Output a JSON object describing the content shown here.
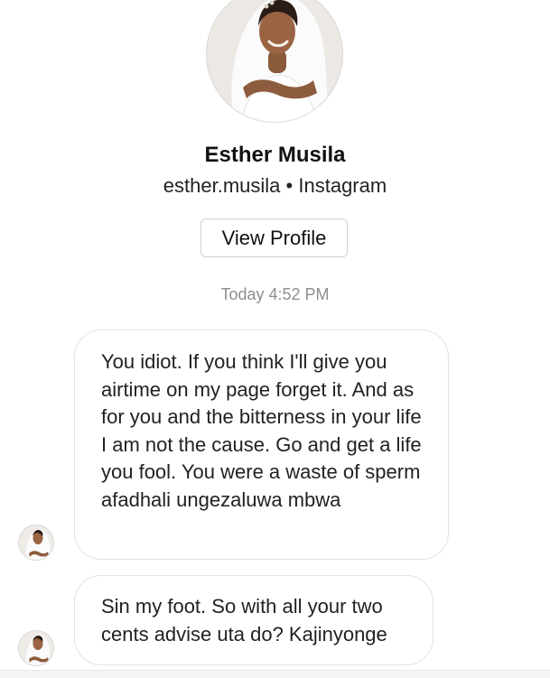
{
  "profile": {
    "name": "Esther Musila",
    "username": "esther.musila",
    "separator": "•",
    "platform": "Instagram",
    "view_profile_label": "View Profile"
  },
  "thread": {
    "timestamp": "Today 4:52 PM",
    "messages": [
      {
        "text": "You idiot. If you think I'll give you airtime on my page forget it. And as for you and the bitterness in your life I am not the cause. Go and get a life you fool. You were a waste of sperm afadhali ungezaluwa mbwa"
      },
      {
        "text": "Sin my foot. So with all your two cents advise uta do? Kajinyonge"
      }
    ]
  },
  "colors": {
    "bubble_border": "#e3e3e3",
    "timestamp": "#8e8e8e",
    "button_border": "#cfcfcf"
  }
}
